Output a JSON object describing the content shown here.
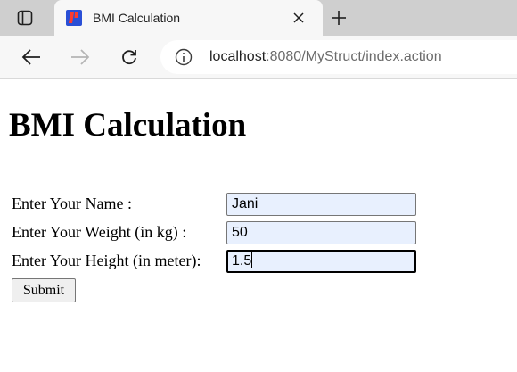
{
  "browser": {
    "tab": {
      "title": "BMI Calculation"
    },
    "address": {
      "host": "localhost",
      "rest": ":8080/MyStruct/index.action"
    },
    "colors": {
      "favicon_bg": "#2a4fd6",
      "favicon_fg": "#ff3b2f"
    }
  },
  "page": {
    "title": "BMI Calculation",
    "form": {
      "name_label": "Enter Your Name :",
      "name_value": "Jani",
      "weight_label": "Enter Your Weight (in kg) :",
      "weight_value": "50",
      "height_label": "Enter Your Height (in meter):",
      "height_value": "1.5",
      "submit_label": "Submit"
    }
  }
}
